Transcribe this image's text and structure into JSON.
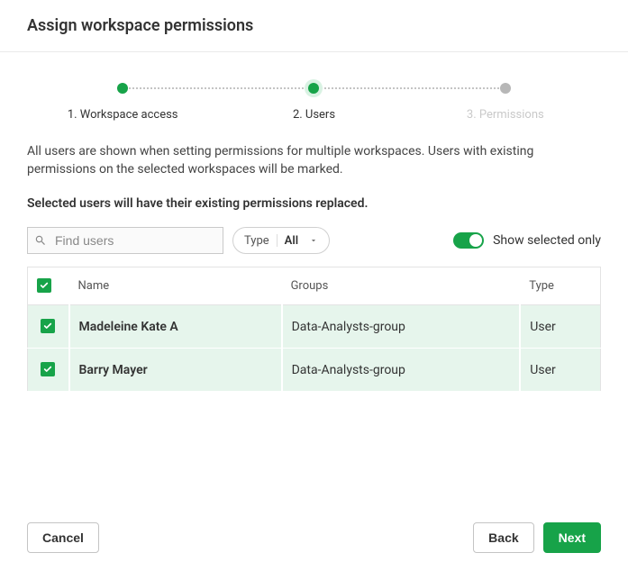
{
  "dialog": {
    "title": "Assign workspace permissions"
  },
  "stepper": {
    "steps": [
      {
        "label": "1. Workspace access",
        "state": "done"
      },
      {
        "label": "2. Users",
        "state": "current"
      },
      {
        "label": "3. Permissions",
        "state": "pending"
      }
    ]
  },
  "intro_text": "All users are shown when setting permissions for multiple workspaces. Users with existing permissions on the selected workspaces will be marked.",
  "bold_note": "Selected users will have their existing permissions replaced.",
  "search": {
    "placeholder": "Find users",
    "value": ""
  },
  "type_filter": {
    "label": "Type",
    "value": "All"
  },
  "toggle": {
    "label": "Show selected only",
    "on": true
  },
  "table": {
    "headers": {
      "name": "Name",
      "groups": "Groups",
      "type": "Type"
    },
    "rows": [
      {
        "selected": true,
        "name": "Madeleine Kate A",
        "groups": "Data-Analysts-group",
        "type": "User"
      },
      {
        "selected": true,
        "name": "Barry Mayer",
        "groups": "Data-Analysts-group",
        "type": "User"
      }
    ]
  },
  "footer": {
    "cancel": "Cancel",
    "back": "Back",
    "next": "Next"
  }
}
